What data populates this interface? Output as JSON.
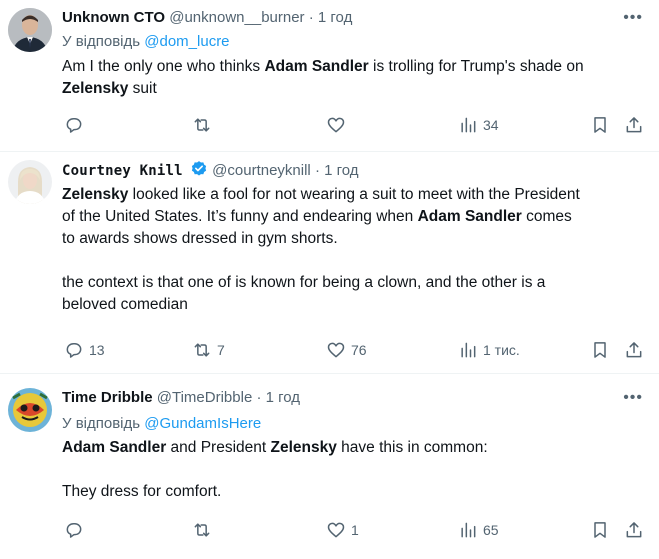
{
  "tweets": [
    {
      "name": "Unknown CTO",
      "handle": "@unknown__burner",
      "sep": "·",
      "time": "1 год",
      "reply_prefix": "У відповідь",
      "reply_to": "@dom_lucre",
      "text_parts": [
        [
          "Am I the only one who thinks ",
          "Adam Sandler",
          " is trolling for Trump's shade on"
        ],
        [
          "Zelensky",
          " suit"
        ]
      ],
      "replies": "",
      "retweets": "",
      "likes": "",
      "views": "34"
    },
    {
      "name": "Courtney Knill",
      "handle": "@courtneyknill",
      "sep": "·",
      "time": "1 год",
      "verified": true,
      "text_parts": [
        [
          "Zelensky",
          " looked like a fool for not wearing a suit to meet with the President"
        ],
        [
          "of the United States. It’s funny and endearing when ",
          "Adam Sandler",
          " comes"
        ],
        [
          "to awards shows dressed in gym shorts."
        ],
        [
          "the context is that one of is known for being a clown, and the other is a"
        ],
        [
          "beloved comedian"
        ]
      ],
      "replies": "13",
      "retweets": "7",
      "likes": "76",
      "views": "1 тис."
    },
    {
      "name": "Time Dribble",
      "handle": "@TimeDribble",
      "sep": "·",
      "time": "1 год",
      "reply_prefix": "У відповідь",
      "reply_to": "@GundamIsHere",
      "text_parts": [
        [
          "Adam Sandler",
          " and President ",
          "Zelensky",
          " have this in common:"
        ],
        [
          "They dress for comfort."
        ]
      ],
      "replies": "",
      "retweets": "",
      "likes": "1",
      "views": "65"
    }
  ],
  "icons": {
    "more": "more-dots-icon",
    "reply": "reply-icon",
    "retweet": "retweet-icon",
    "like": "heart-icon",
    "views": "views-chart-icon",
    "bookmark": "bookmark-icon",
    "share": "share-icon",
    "verified": "verified-badge-icon"
  },
  "colors": {
    "link": "#1d9bf0",
    "muted": "#536471",
    "text": "#0f1419",
    "verified": "#1d9bf0"
  }
}
